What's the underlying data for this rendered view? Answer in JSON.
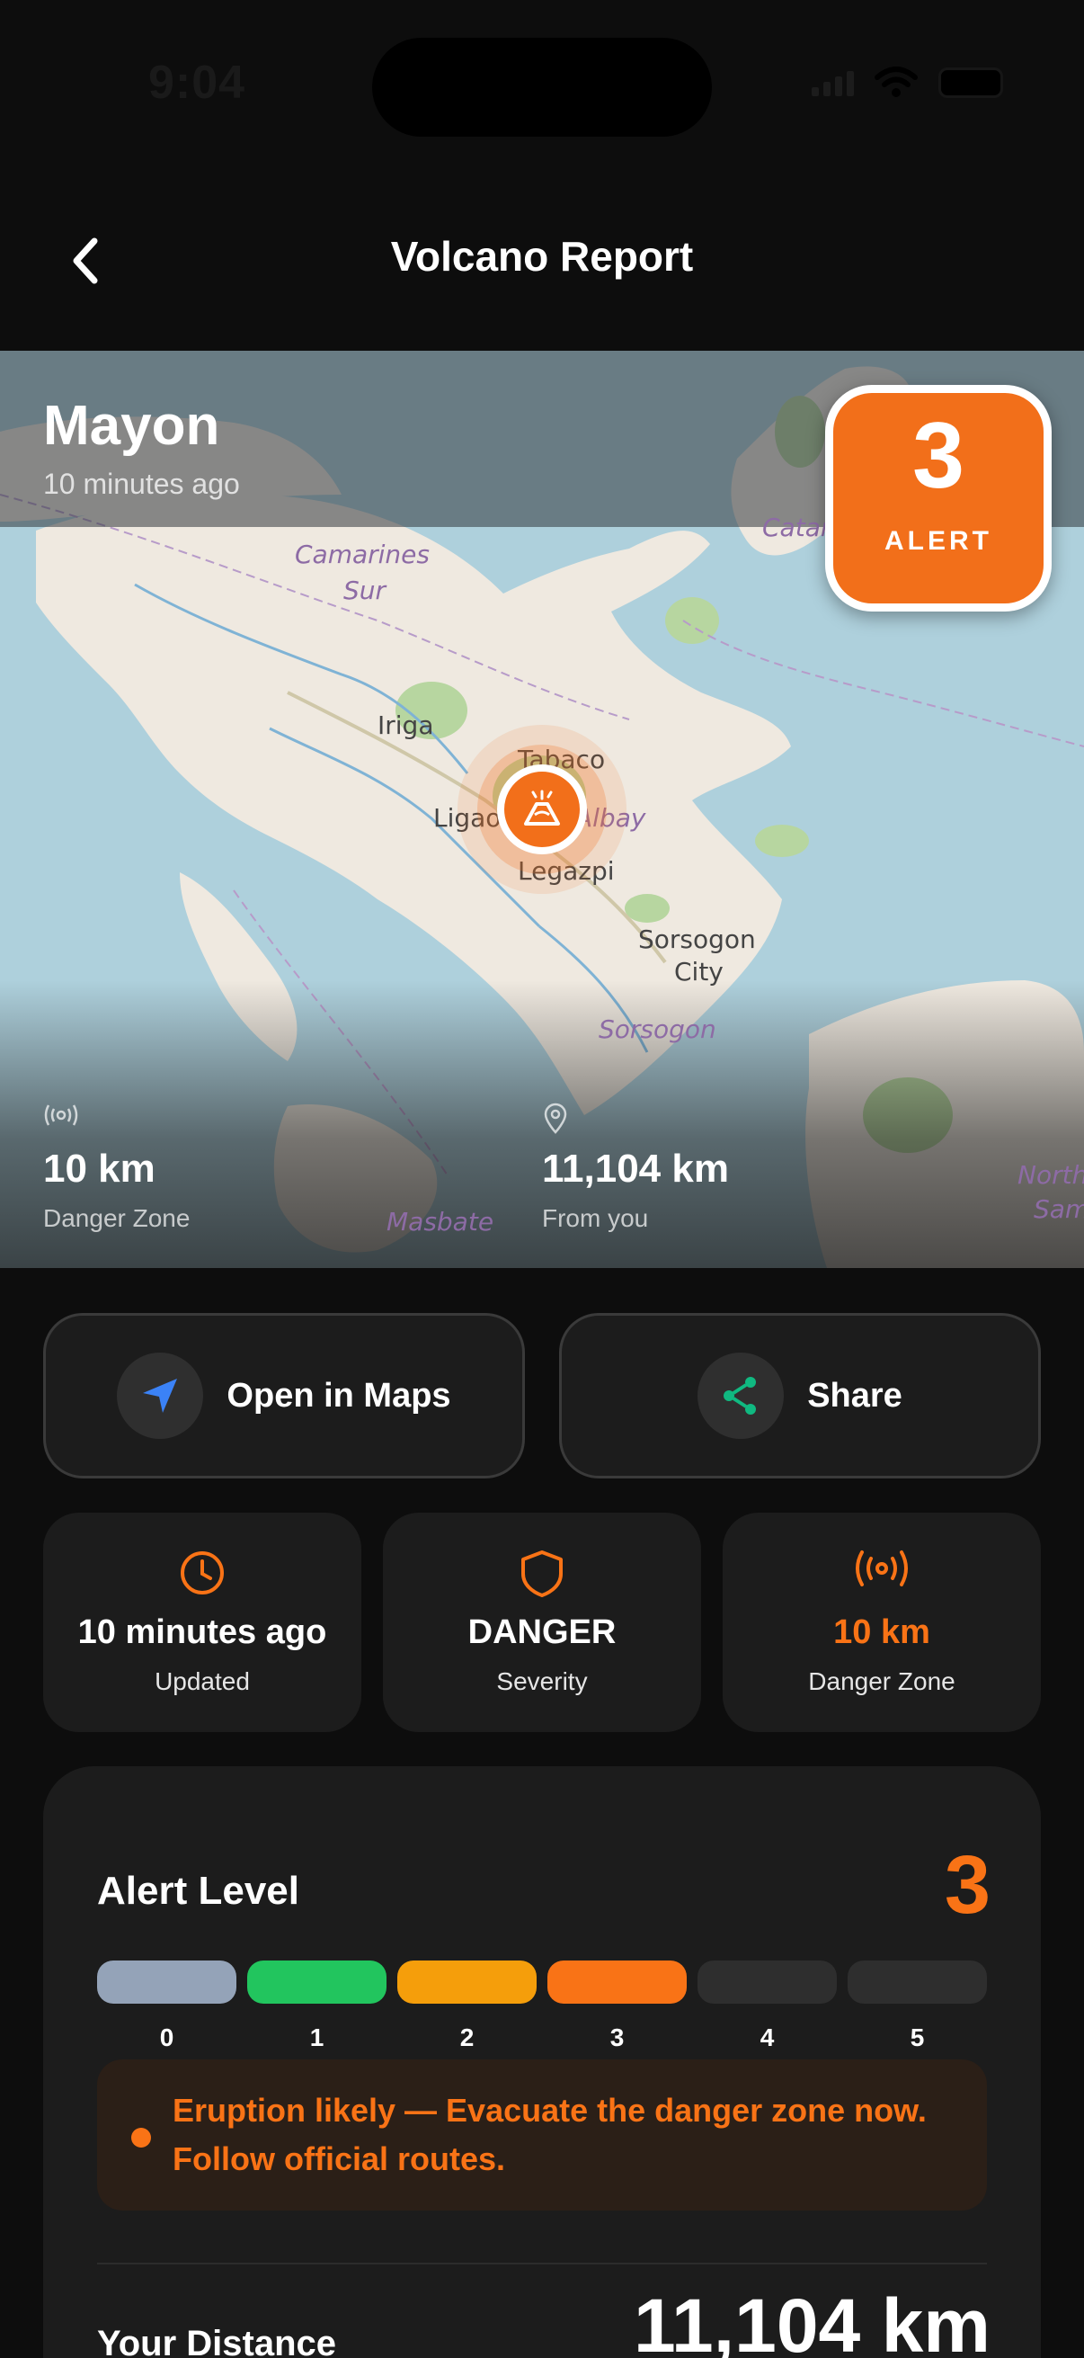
{
  "status_bar": {
    "time": "9:04"
  },
  "header": {
    "title": "Volcano Report",
    "back_icon": "chevron-left-icon"
  },
  "map": {
    "volcano_name": "Mayon",
    "updated": "10 minutes ago",
    "alert_badge": {
      "number": "3",
      "label": "ALERT"
    },
    "place_labels": [
      {
        "text": "Camarines",
        "italic": true
      },
      {
        "text": "Sur",
        "italic": true
      },
      {
        "text": "Iriga",
        "italic": false
      },
      {
        "text": "Tabaco",
        "italic": false
      },
      {
        "text": "Ligao",
        "italic": false
      },
      {
        "text": "Albay",
        "italic": true
      },
      {
        "text": "Legazpi",
        "italic": false
      },
      {
        "text": "Sorsogon",
        "italic": false
      },
      {
        "text": "City",
        "italic": false
      },
      {
        "text": "Sorsogon",
        "italic": true
      },
      {
        "text": "Catanduanes",
        "italic": true
      },
      {
        "text": "Masbate",
        "italic": true
      },
      {
        "text": "North",
        "italic": true
      },
      {
        "text": "Samar",
        "italic": true
      }
    ],
    "stats": [
      {
        "icon": "broadcast-icon",
        "value": "10 km",
        "label": "Danger Zone"
      },
      {
        "icon": "location-pin-icon",
        "value": "11,104 km",
        "label": "From you"
      }
    ]
  },
  "actions": {
    "open_maps": {
      "label": "Open in Maps",
      "icon": "navigation-arrow-icon"
    },
    "share": {
      "label": "Share",
      "icon": "share-icon"
    }
  },
  "stat_cards": [
    {
      "icon": "clock-icon",
      "value": "10 minutes ago",
      "label": "Updated",
      "color": "#ffffff"
    },
    {
      "icon": "shield-icon",
      "value": "DANGER",
      "label": "Severity",
      "color": "#ffffff"
    },
    {
      "icon": "broadcast-icon",
      "value": "10 km",
      "label": "Danger Zone",
      "color": "#f97316"
    }
  ],
  "alert_level": {
    "title": "Alert Level",
    "current": "3",
    "levels": [
      {
        "label": "0",
        "color": "#94a3b8"
      },
      {
        "label": "1",
        "color": "#22c55e"
      },
      {
        "label": "2",
        "color": "#f59e0b"
      },
      {
        "label": "3",
        "color": "#f97316"
      },
      {
        "label": "4",
        "color": "#2e2e2e"
      },
      {
        "label": "5",
        "color": "#2e2e2e"
      }
    ],
    "message": "Eruption likely — Evacuate the danger zone now. Follow official routes.",
    "distance_label": "Your Distance",
    "distance_value": "11,104 km"
  },
  "colors": {
    "accent": "#f97316",
    "background": "#0d0d0d",
    "card": "#1c1c1c"
  }
}
